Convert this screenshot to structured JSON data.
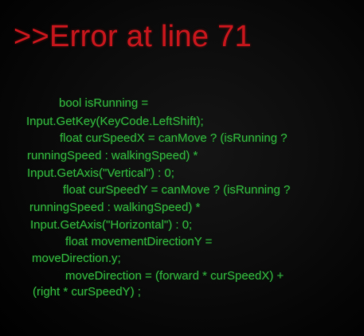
{
  "error": {
    "title": ">>Error at line 71"
  },
  "code_lines": [
    "bool isRunning =",
    "Input.GetKey(KeyCode.LeftShift);",
    "float curSpeedX = canMove ? (isRunning ?",
    "runningSpeed : walkingSpeed) *",
    "Input.GetAxis(\"Vertical\") : 0;",
    "float curSpeedY = canMove ? (isRunning ?",
    "runningSpeed : walkingSpeed) *",
    "Input.GetAxis(\"Horizontal\") : 0;",
    "float movementDirectionY =",
    "moveDirection.y;",
    "moveDirection = (forward * curSpeedX) +",
    "(right * curSpeedY) ;"
  ],
  "colors": {
    "error_text": "#c4161c",
    "code_text": "#2fa83a",
    "background": "#0c0c0c"
  }
}
